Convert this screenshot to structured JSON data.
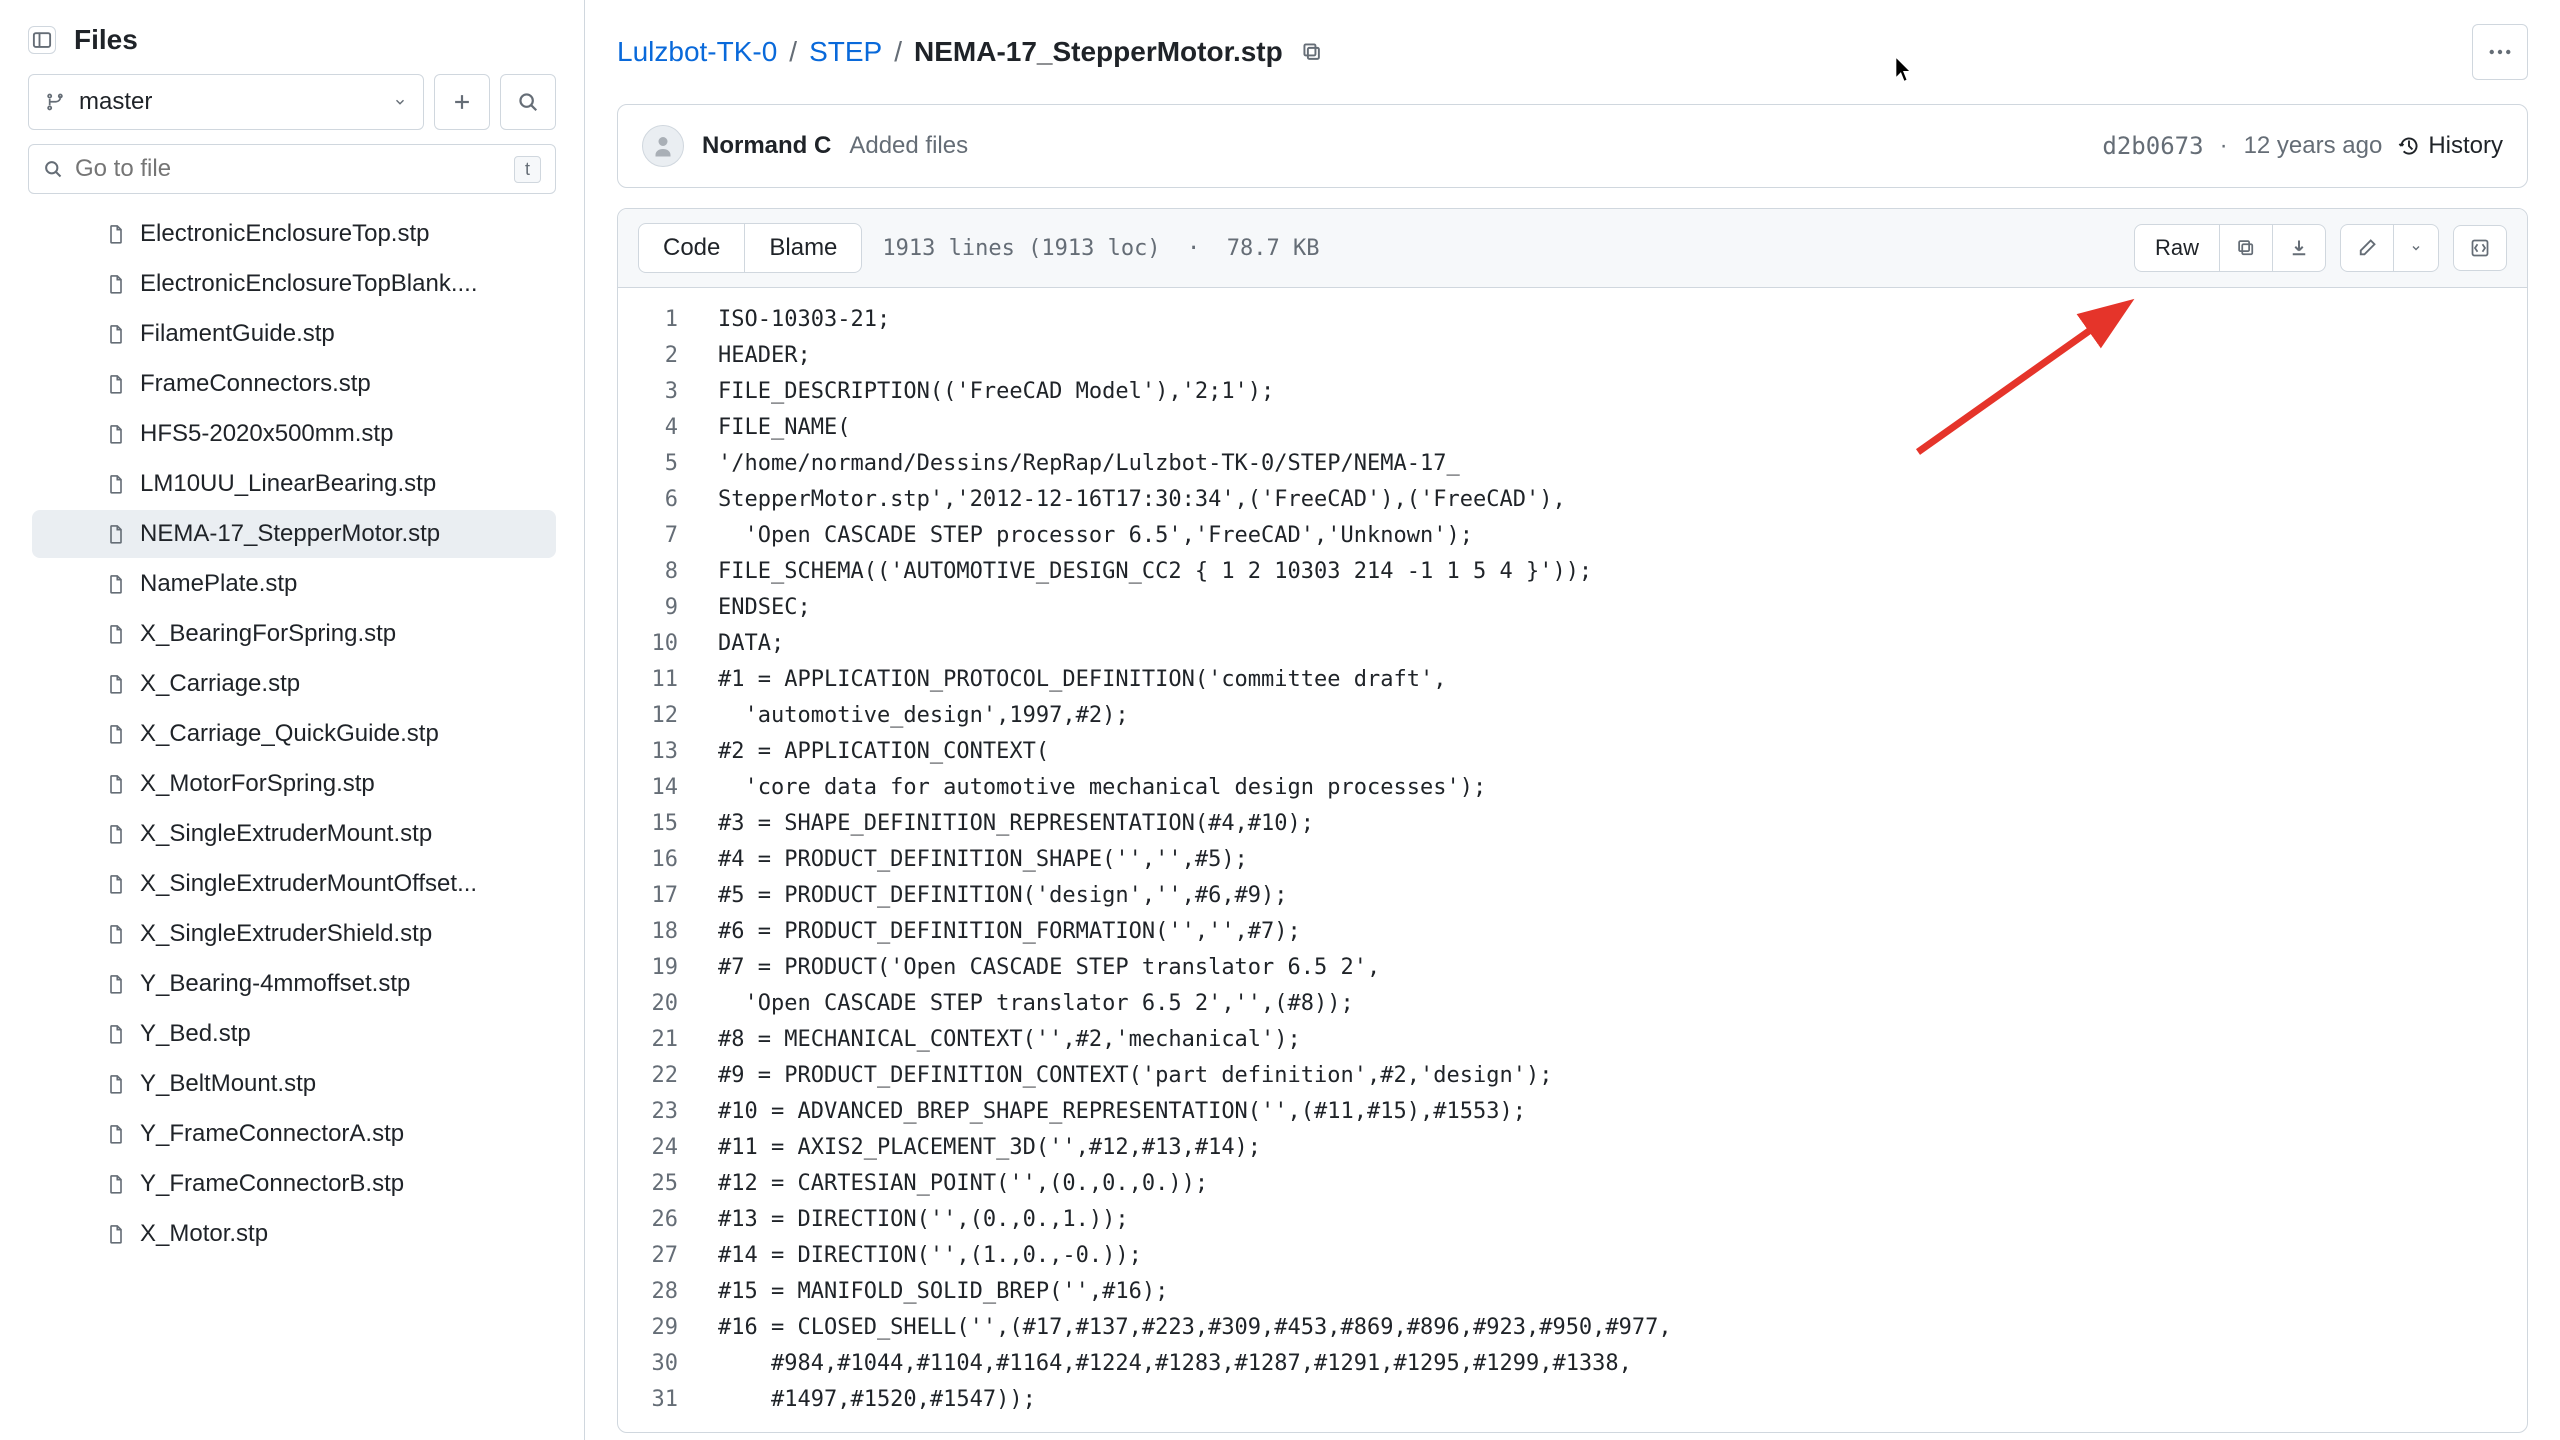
{
  "sidebar": {
    "title": "Files",
    "branch": "master",
    "search_placeholder": "Go to file",
    "search_kbd": "t",
    "files": [
      {
        "name": "ElectronicEnclosureTop.stp",
        "active": false
      },
      {
        "name": "ElectronicEnclosureTopBlank....",
        "active": false
      },
      {
        "name": "FilamentGuide.stp",
        "active": false
      },
      {
        "name": "FrameConnectors.stp",
        "active": false
      },
      {
        "name": "HFS5-2020x500mm.stp",
        "active": false
      },
      {
        "name": "LM10UU_LinearBearing.stp",
        "active": false
      },
      {
        "name": "NEMA-17_StepperMotor.stp",
        "active": true
      },
      {
        "name": "NamePlate.stp",
        "active": false
      },
      {
        "name": "X_BearingForSpring.stp",
        "active": false
      },
      {
        "name": "X_Carriage.stp",
        "active": false
      },
      {
        "name": "X_Carriage_QuickGuide.stp",
        "active": false
      },
      {
        "name": "X_MotorForSpring.stp",
        "active": false
      },
      {
        "name": "X_SingleExtruderMount.stp",
        "active": false
      },
      {
        "name": "X_SingleExtruderMountOffset...",
        "active": false
      },
      {
        "name": "X_SingleExtruderShield.stp",
        "active": false
      },
      {
        "name": "Y_Bearing-4mmoffset.stp",
        "active": false
      },
      {
        "name": "Y_Bed.stp",
        "active": false
      },
      {
        "name": "Y_BeltMount.stp",
        "active": false
      },
      {
        "name": "Y_FrameConnectorA.stp",
        "active": false
      },
      {
        "name": "Y_FrameConnectorB.stp",
        "active": false
      },
      {
        "name": "X_Motor.stp",
        "active": false
      }
    ]
  },
  "breadcrumb": {
    "root": "Lulzbot-TK-0",
    "folder": "STEP",
    "file": "NEMA-17_StepperMotor.stp"
  },
  "commit": {
    "author": "Normand C",
    "message": "Added files",
    "sha": "d2b0673",
    "age": "12 years ago",
    "history_label": "History"
  },
  "toolbar": {
    "code_tab": "Code",
    "blame_tab": "Blame",
    "stats": "1913 lines (1913 loc)  ·  78.7 KB",
    "raw_label": "Raw"
  },
  "code": [
    {
      "n": 1,
      "t": "ISO-10303-21;"
    },
    {
      "n": 2,
      "t": "HEADER;"
    },
    {
      "n": 3,
      "t": "FILE_DESCRIPTION(('FreeCAD Model'),'2;1');"
    },
    {
      "n": 4,
      "t": "FILE_NAME("
    },
    {
      "n": 5,
      "t": "'/home/normand/Dessins/RepRap/Lulzbot-TK-0/STEP/NEMA-17_"
    },
    {
      "n": 6,
      "t": "StepperMotor.stp','2012-12-16T17:30:34',('FreeCAD'),('FreeCAD'),"
    },
    {
      "n": 7,
      "t": "  'Open CASCADE STEP processor 6.5','FreeCAD','Unknown');"
    },
    {
      "n": 8,
      "t": "FILE_SCHEMA(('AUTOMOTIVE_DESIGN_CC2 { 1 2 10303 214 -1 1 5 4 }'));"
    },
    {
      "n": 9,
      "t": "ENDSEC;"
    },
    {
      "n": 10,
      "t": "DATA;"
    },
    {
      "n": 11,
      "t": "#1 = APPLICATION_PROTOCOL_DEFINITION('committee draft',"
    },
    {
      "n": 12,
      "t": "  'automotive_design',1997,#2);"
    },
    {
      "n": 13,
      "t": "#2 = APPLICATION_CONTEXT("
    },
    {
      "n": 14,
      "t": "  'core data for automotive mechanical design processes');"
    },
    {
      "n": 15,
      "t": "#3 = SHAPE_DEFINITION_REPRESENTATION(#4,#10);"
    },
    {
      "n": 16,
      "t": "#4 = PRODUCT_DEFINITION_SHAPE('','',#5);"
    },
    {
      "n": 17,
      "t": "#5 = PRODUCT_DEFINITION('design','',#6,#9);"
    },
    {
      "n": 18,
      "t": "#6 = PRODUCT_DEFINITION_FORMATION('','',#7);"
    },
    {
      "n": 19,
      "t": "#7 = PRODUCT('Open CASCADE STEP translator 6.5 2',"
    },
    {
      "n": 20,
      "t": "  'Open CASCADE STEP translator 6.5 2','',(#8));"
    },
    {
      "n": 21,
      "t": "#8 = MECHANICAL_CONTEXT('',#2,'mechanical');"
    },
    {
      "n": 22,
      "t": "#9 = PRODUCT_DEFINITION_CONTEXT('part definition',#2,'design');"
    },
    {
      "n": 23,
      "t": "#10 = ADVANCED_BREP_SHAPE_REPRESENTATION('',(#11,#15),#1553);"
    },
    {
      "n": 24,
      "t": "#11 = AXIS2_PLACEMENT_3D('',#12,#13,#14);"
    },
    {
      "n": 25,
      "t": "#12 = CARTESIAN_POINT('',(0.,0.,0.));"
    },
    {
      "n": 26,
      "t": "#13 = DIRECTION('',(0.,0.,1.));"
    },
    {
      "n": 27,
      "t": "#14 = DIRECTION('',(1.,0.,-0.));"
    },
    {
      "n": 28,
      "t": "#15 = MANIFOLD_SOLID_BREP('',#16);"
    },
    {
      "n": 29,
      "t": "#16 = CLOSED_SHELL('',(#17,#137,#223,#309,#453,#869,#896,#923,#950,#977,"
    },
    {
      "n": 30,
      "t": "    #984,#1044,#1104,#1164,#1224,#1283,#1287,#1291,#1295,#1299,#1338,"
    },
    {
      "n": 31,
      "t": "    #1497,#1520,#1547));"
    }
  ]
}
